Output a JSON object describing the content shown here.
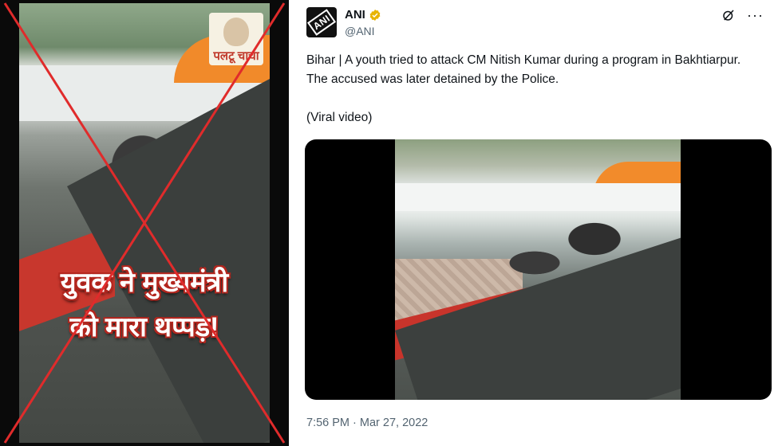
{
  "viral_frame": {
    "caption_line1": "युवक ने मुख्यमंत्री",
    "caption_line2": "को मारा थप्पड़!",
    "logo_text": "पलटू चाचा",
    "mark": "red-cross",
    "mark_color": "#e02b2b"
  },
  "tweet": {
    "author_name": "ANI",
    "author_handle": "@ANI",
    "avatar_text": "ANI",
    "verified_color": "#e8b400",
    "text_line1": "Bihar | A youth tried to attack CM Nitish Kumar during a program in Bakhtiarpur. The accused was later detained by the Police.",
    "text_line2": "(Viral video)",
    "timestamp": "7:56 PM · Mar 27, 2022",
    "icons": [
      "grok-icon",
      "more-icon"
    ]
  }
}
